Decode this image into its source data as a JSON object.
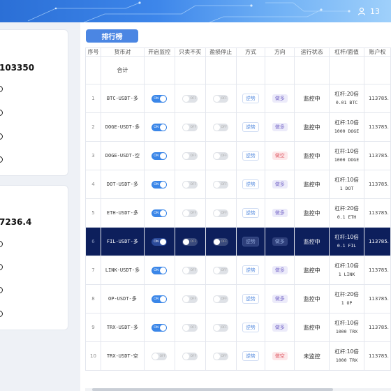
{
  "header": {
    "user_fragment": "13",
    "user_icon": "user-icon"
  },
  "left_panel": {
    "card1_value": "103350",
    "card2_value": "7236.4"
  },
  "rank_button": "排行榜",
  "table": {
    "columns": [
      "序号",
      "货币对",
      "开启监控",
      "只卖不买",
      "盈损停止",
      "方式",
      "方向",
      "运行状态",
      "杠杆/面值",
      "账户权"
    ],
    "total_label": "合计",
    "toggle_on_label": "ON",
    "toggle_off_label": "OFF",
    "rows": [
      {
        "seq": "1",
        "pair": "BTC-USDT-多",
        "monitor": "on",
        "sell_only": "off",
        "stop": "off",
        "mode": "逆势",
        "direction": "做多",
        "dir_type": "long",
        "status": "监控中",
        "leverage": "杠杆:20倍",
        "amount": "0.01 BTC",
        "account": "113785."
      },
      {
        "seq": "2",
        "pair": "DOGE-USDT-多",
        "monitor": "on",
        "sell_only": "off",
        "stop": "off",
        "mode": "逆势",
        "direction": "做多",
        "dir_type": "long",
        "status": "监控中",
        "leverage": "杠杆:10倍",
        "amount": "1000 DOGE",
        "account": "113785."
      },
      {
        "seq": "3",
        "pair": "DOGE-USDT-空",
        "monitor": "on",
        "sell_only": "off",
        "stop": "off",
        "mode": "逆势",
        "direction": "做空",
        "dir_type": "short",
        "status": "监控中",
        "leverage": "杠杆:10倍",
        "amount": "1000 DOGE",
        "account": "113785."
      },
      {
        "seq": "4",
        "pair": "DOT-USDT-多",
        "monitor": "on",
        "sell_only": "off",
        "stop": "off",
        "mode": "逆势",
        "direction": "做多",
        "dir_type": "long",
        "status": "监控中",
        "leverage": "杠杆:10倍",
        "amount": "1 DOT",
        "account": "113785."
      },
      {
        "seq": "5",
        "pair": "ETH-USDT-多",
        "monitor": "on",
        "sell_only": "off",
        "stop": "off",
        "mode": "逆势",
        "direction": "做多",
        "dir_type": "long",
        "status": "监控中",
        "leverage": "杠杆:20倍",
        "amount": "0.1 ETH",
        "account": "113785."
      },
      {
        "seq": "6",
        "pair": "FIL-USDT-多",
        "monitor": "on",
        "sell_only": "off",
        "stop": "off",
        "mode": "逆势",
        "direction": "做多",
        "dir_type": "long",
        "status": "监控中",
        "leverage": "杠杆:10倍",
        "amount": "0.1 FIL",
        "account": "113785."
      },
      {
        "seq": "7",
        "pair": "LINK-USDT-多",
        "monitor": "on",
        "sell_only": "off",
        "stop": "off",
        "mode": "逆势",
        "direction": "做多",
        "dir_type": "long",
        "status": "监控中",
        "leverage": "杠杆:10倍",
        "amount": "1 LINK",
        "account": "113785."
      },
      {
        "seq": "8",
        "pair": "OP-USDT-多",
        "monitor": "on",
        "sell_only": "off",
        "stop": "off",
        "mode": "逆势",
        "direction": "做多",
        "dir_type": "long",
        "status": "监控中",
        "leverage": "杠杆:20倍",
        "amount": "1 OP",
        "account": "113785."
      },
      {
        "seq": "9",
        "pair": "TRX-USDT-多",
        "monitor": "on",
        "sell_only": "off",
        "stop": "off",
        "mode": "逆势",
        "direction": "做多",
        "dir_type": "long",
        "status": "监控中",
        "leverage": "杠杆:10倍",
        "amount": "1000 TRX",
        "account": "113785."
      },
      {
        "seq": "10",
        "pair": "TRX-USDT-空",
        "monitor": "off",
        "sell_only": "off",
        "stop": "off",
        "mode": "逆势",
        "direction": "做空",
        "dir_type": "short",
        "status": "未监控",
        "leverage": "杠杆:10倍",
        "amount": "1000 TRX",
        "account": "113785."
      }
    ],
    "selected_row": 5
  },
  "colors": {
    "header_blue": "#2b6fd6",
    "toggle_on": "#3a86e8",
    "selected_row": "#0d1f5c",
    "short_tag": "#e0606a",
    "long_tag": "#7a6bc9"
  }
}
